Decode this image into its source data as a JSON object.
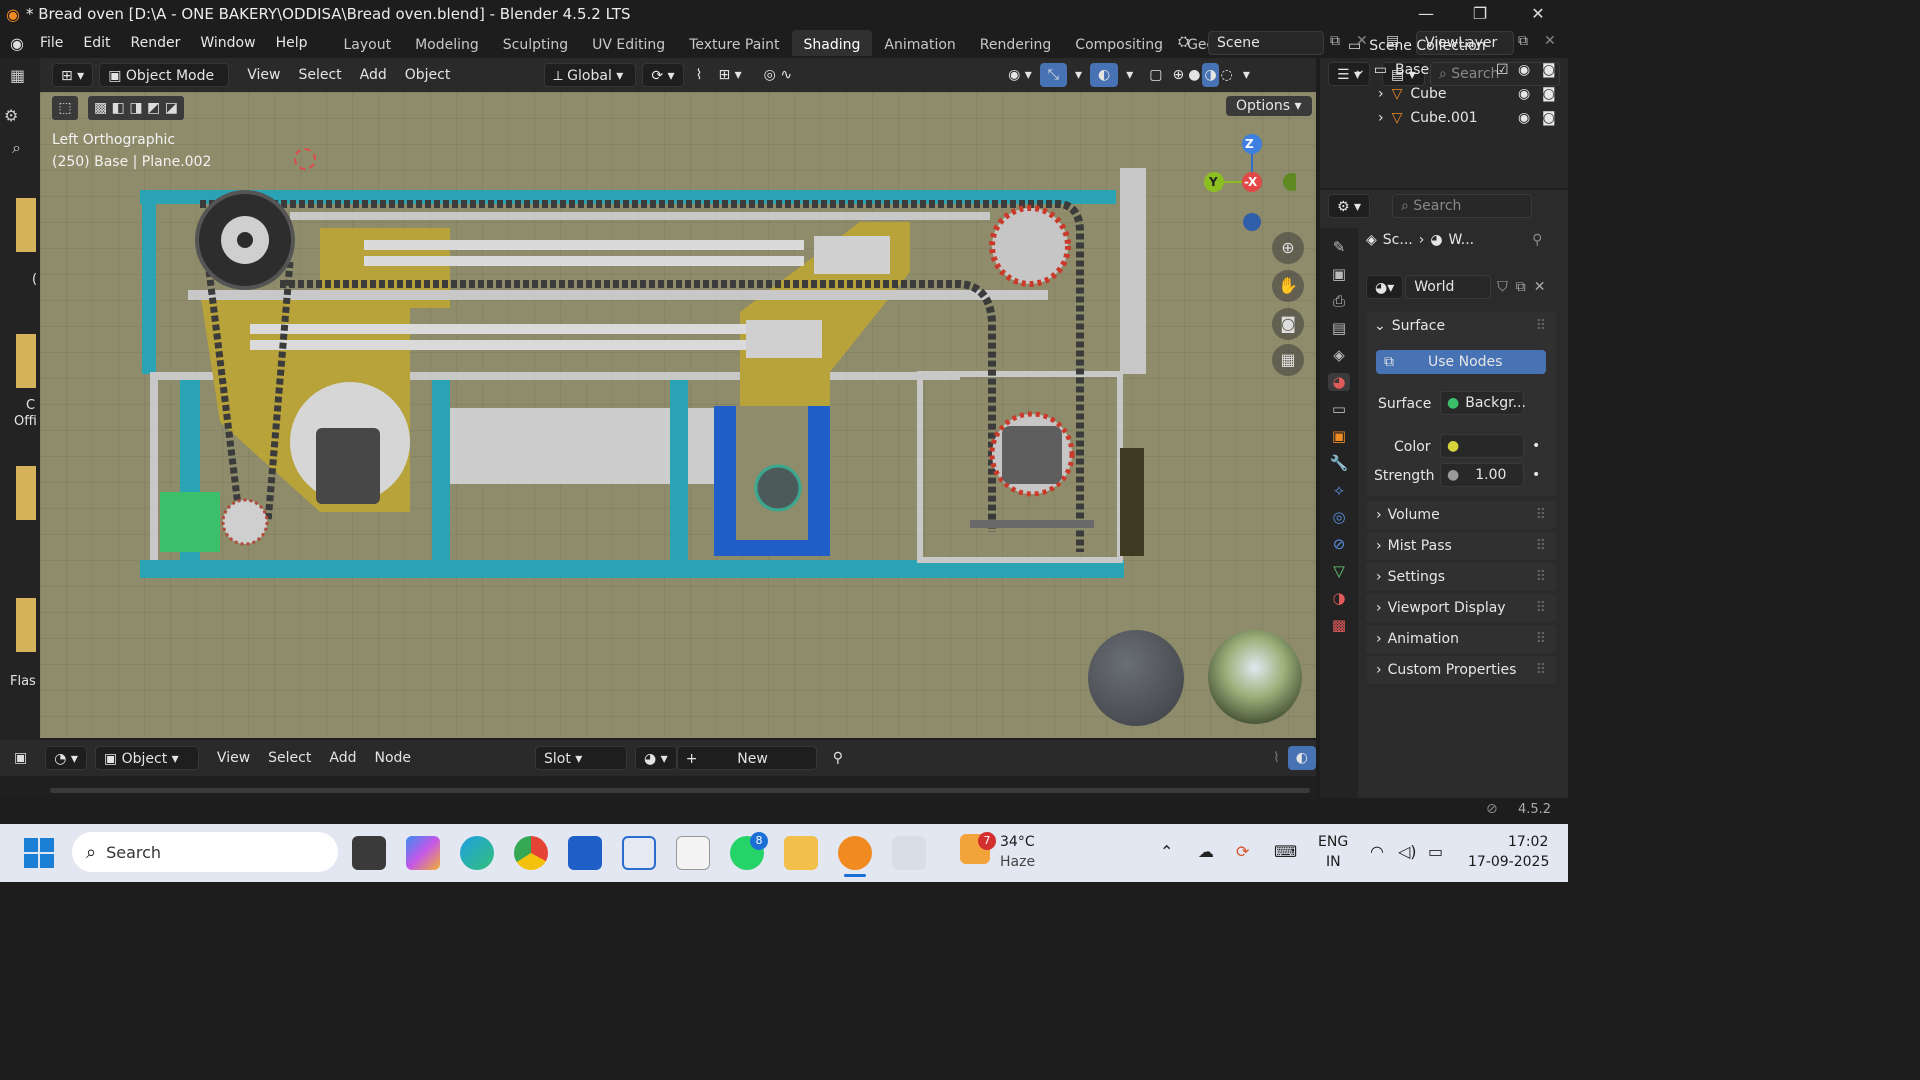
{
  "window": {
    "title": "* Bread oven [D:\\A - ONE BAKERY\\ODDISA\\Bread oven.blend] - Blender 4.5.2 LTS",
    "minimize": "—",
    "maximize": "❐",
    "close": "✕"
  },
  "menu": {
    "items": [
      "File",
      "Edit",
      "Render",
      "Window",
      "Help"
    ]
  },
  "workspaces": {
    "tabs": [
      "Layout",
      "Modeling",
      "Sculpting",
      "UV Editing",
      "Texture Paint",
      "Shading",
      "Animation",
      "Rendering",
      "Compositing",
      "Geome"
    ],
    "active": "Shading"
  },
  "scene": {
    "name": "Scene",
    "view_layer": "ViewLayer"
  },
  "viewport_header": {
    "mode": "Object Mode",
    "menus": [
      "View",
      "Select",
      "Add",
      "Object"
    ],
    "transform_orientation": "Global"
  },
  "viewport": {
    "view_name": "Left Orthographic",
    "object_info": "(250) Base | Plane.002",
    "options_label": "Options",
    "gizmo": {
      "z": "Z",
      "x": "-X",
      "y": "Y"
    }
  },
  "left_strip": {
    "labels": [
      "(",
      "C",
      "Offi",
      "Flas"
    ]
  },
  "node_header": {
    "type": "Object",
    "menus": [
      "View",
      "Select",
      "Add",
      "Node"
    ],
    "slot": "Slot",
    "new_label": "New"
  },
  "outliner": {
    "search_placeholder": "Search",
    "root": "Scene Collection",
    "items": [
      {
        "name": "Base",
        "kind": "collection"
      },
      {
        "name": "Cube",
        "kind": "mesh"
      },
      {
        "name": "Cube.001",
        "kind": "mesh"
      }
    ]
  },
  "properties": {
    "search_placeholder": "Search",
    "breadcrumb": [
      "Sc...",
      "W..."
    ],
    "world_name": "World",
    "surface_section": "Surface",
    "use_nodes": "Use Nodes",
    "surface_label": "Surface",
    "surface_value": "Backgr...",
    "color_label": "Color",
    "strength_label": "Strength",
    "strength_value": "1.00",
    "collapsed_sections": [
      "Volume",
      "Mist Pass",
      "Settings",
      "Viewport Display",
      "Animation",
      "Custom Properties"
    ]
  },
  "status": {
    "version": "4.5.2"
  },
  "taskbar": {
    "search_placeholder": "Search",
    "whatsapp_badge": "8",
    "weather_badge": "7",
    "weather_temp": "34°C",
    "weather_desc": "Haze",
    "lang": "ENG",
    "region": "IN",
    "time": "17:02",
    "date": "17-09-2025"
  },
  "colors": {
    "accent_blue": "#4772b3",
    "viewport_bg": "#8e8c6a",
    "frame_teal": "#2aa3b5",
    "mustard": "#b8a23a"
  }
}
